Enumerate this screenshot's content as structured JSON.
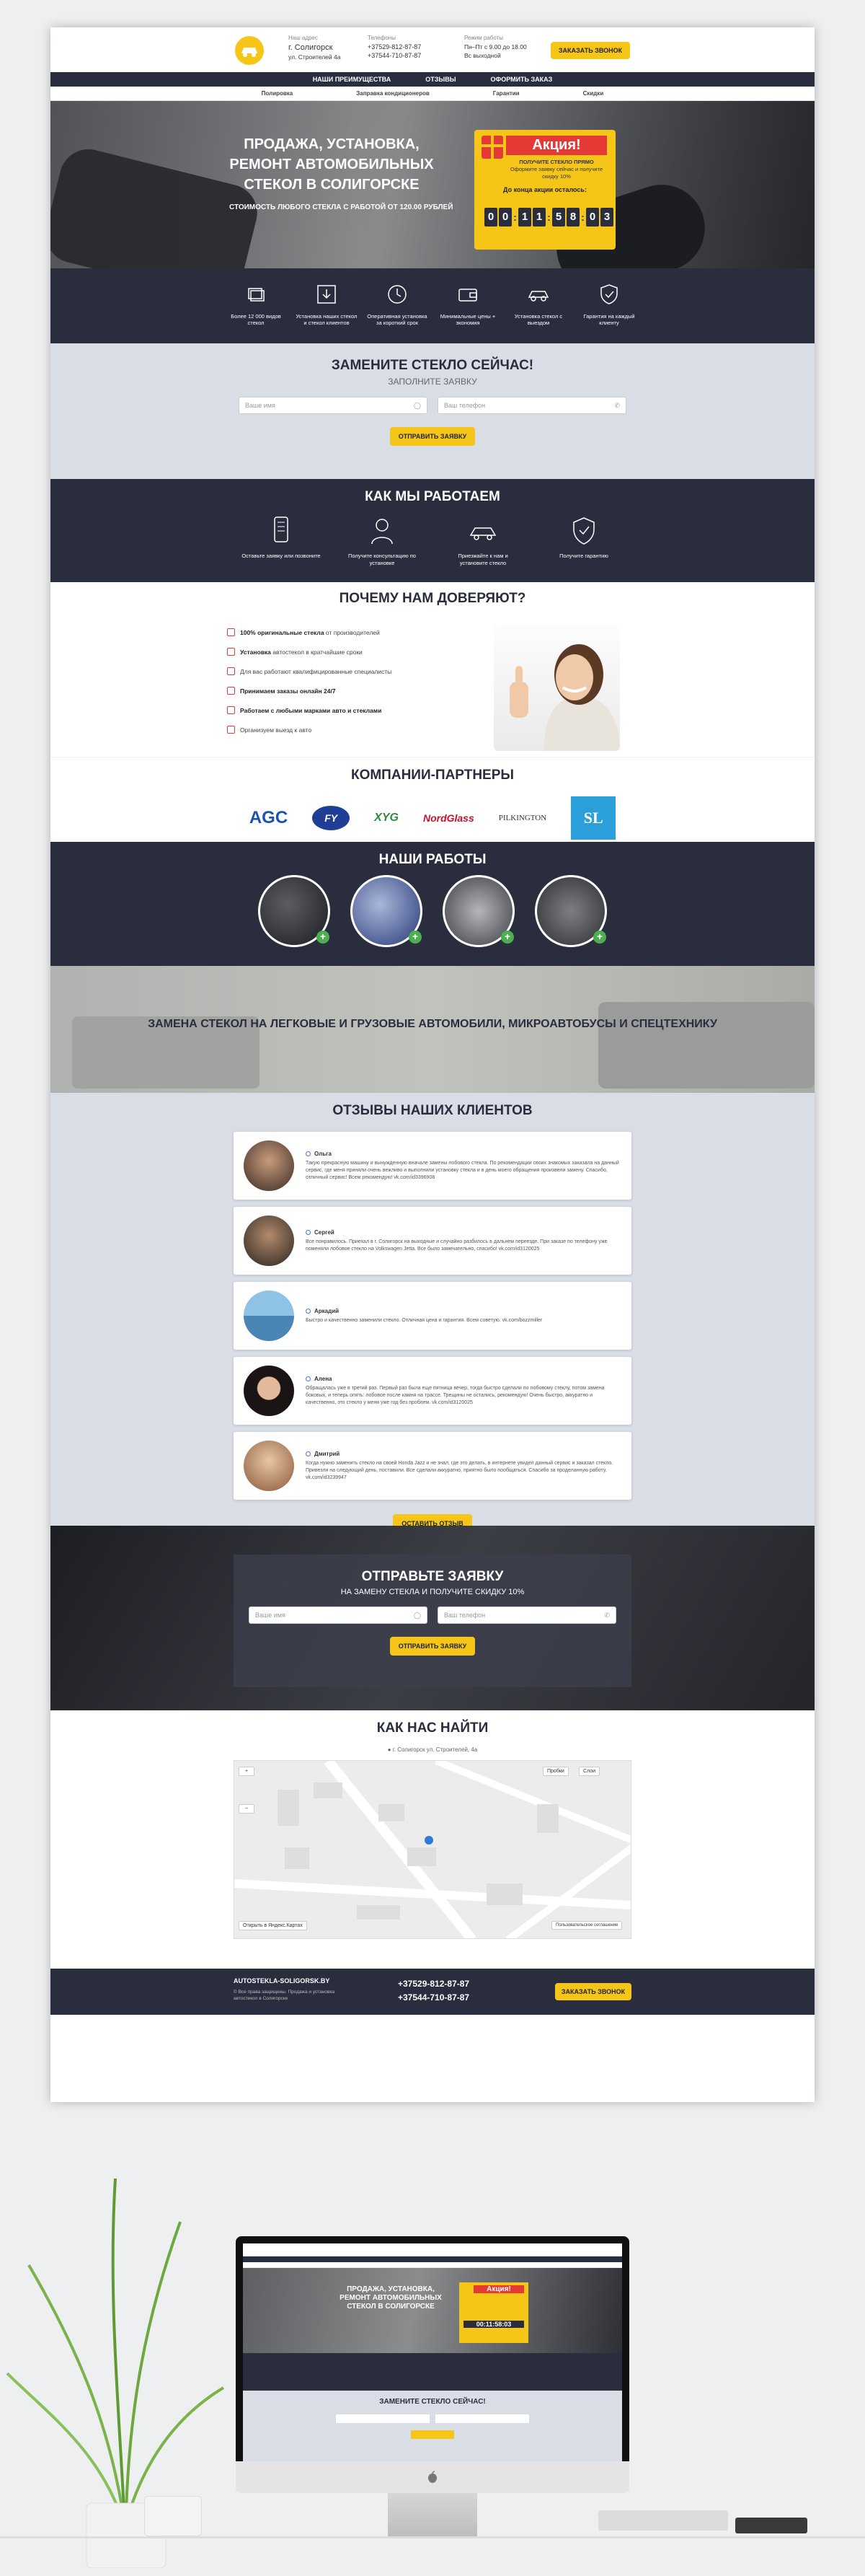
{
  "header": {
    "city_label": "Наш адрес",
    "city": "г. Солигорск",
    "street": "ул. Строителей 4а",
    "phones_label": "Телефоны",
    "phone1": "+37529-812-87-87",
    "phone2": "+37544-710-87-87",
    "hours_label": "Режим работы",
    "hours1": "Пн–Пт с 9.00 до 18.00",
    "hours2": "Вс выходной",
    "call_button": "Заказать звонок"
  },
  "nav_main": [
    "Наши преимущества",
    "Отзывы",
    "Оформить заказ"
  ],
  "nav_sub": [
    "Полировка",
    "Заправка кондиционеров",
    "Гарантии",
    "Скидки"
  ],
  "hero": {
    "title": "Продажа, установка, ремонт автомобильных стекол в Солигорске",
    "price": "Стоимость любого стекла с работой от 120.00 рублей",
    "promo_title": "Акция!",
    "promo_text": "Оформите заявку сейчас и получите скидку 10%",
    "promo_prefix": "ПОЛУЧИТЕ СТЕКЛО ПРЯМО",
    "countdown_label": "До конца акции осталось:",
    "timer": [
      "0",
      "0",
      "1",
      "1",
      "5",
      "8",
      "0",
      "3"
    ]
  },
  "features": [
    {
      "icon": "glass-stack-icon",
      "text": "Более 12 000 видов стекол"
    },
    {
      "icon": "download-box-icon",
      "text": "Установка наших стекол и стекол клиентов"
    },
    {
      "icon": "clock-icon",
      "text": "Оперативная установка за короткий срок"
    },
    {
      "icon": "wallet-icon",
      "text": "Минимальные цены + экономия"
    },
    {
      "icon": "car-icon",
      "text": "Установка стекол с выездом"
    },
    {
      "icon": "shield-check-icon",
      "text": "Гарантия на каждый клиенту"
    }
  ],
  "form1": {
    "title": "Замените стекло сейчас!",
    "subtitle": "Заполните заявку",
    "name_placeholder": "Ваше имя",
    "phone_placeholder": "Ваш телефон",
    "submit": "Отправить заявку"
  },
  "how": {
    "title": "Как мы работаем",
    "steps": [
      {
        "icon": "phone-icon",
        "text": "Оставьте заявку или позвоните"
      },
      {
        "icon": "consultant-icon",
        "text": "Получите консультацию по установке"
      },
      {
        "icon": "car-icon",
        "text": "Приезжайте к нам и установите стекло"
      },
      {
        "icon": "shield-check-icon",
        "text": "Получите гарантию"
      }
    ]
  },
  "trust": {
    "title": "Почему нам доверяют?",
    "items": [
      {
        "bold": "100% оригинальные стекла",
        "rest": " от производителей"
      },
      {
        "bold": "Установка",
        "rest": " автостекол в кратчайшие сроки"
      },
      {
        "bold": "",
        "rest": "Для вас работают квалифицированные специалисты"
      },
      {
        "bold": "Принимаем заказы онлайн 24/7",
        "rest": ""
      },
      {
        "bold": "Работаем с любыми марками авто и стеклами",
        "rest": ""
      },
      {
        "bold": "",
        "rest": "Организуем выезд к авто"
      }
    ]
  },
  "partners": {
    "title": "Компании-партнеры",
    "logos": [
      "AGC",
      "FY",
      "XYG",
      "NordGlass",
      "PILKINGTON",
      "SL"
    ]
  },
  "works": {
    "title": "Наши работы",
    "plus": "+"
  },
  "trucks": {
    "title": "Замена стекол на легковые и грузовые автомобили, микроавтобусы и спецтехнику"
  },
  "reviews": {
    "title": "Отзывы наших клиентов",
    "items": [
      {
        "name": "Ольга",
        "text": "Такую прекрасную машину и вынужденную вначале замены лобового стекла. По рекомендации своих знакомых заказала на данный сервис, где меня приняли очень вежливо и выполнили установку стекла и в день моего обращения произвели замену. Спасибо, отличный сервис! Всем рекомендую! vk.com/id3396908"
      },
      {
        "name": "Сергей",
        "text": "Все понравилось. Приехал в г. Солигорск на выходные и случайно разбилось в дальнем переезде. При заказе по телефону уже поменяли лобовое стекло на Volkswagen Jetta. Все было замечательно, спасибо! vk.com/id3120025"
      },
      {
        "name": "Аркадий",
        "text": "Быстро и качественно заменили стекло. Отличная цена и гарантия. Всем советую. vk.com/bozzmiller"
      },
      {
        "name": "Алена",
        "text": "Обращалась уже в третий раз. Первый раз была еще пятница вечер, тогда быстро сделали по лобовому стеклу, потом замена боковых, и теперь опять: лобовое после камня на трассе. Трещины не остались, рекомендую! Очень быстро, аккуратно и качественно, это стекло у меня уже год без проблем. vk.com/id3120025"
      },
      {
        "name": "Дмитрий",
        "text": "Когда нужно заменить стекло на своей Honda Jazz и не знал, где это делать, в интернете увидел данный сервис и заказал стекло. Привезли на следующий день, поставили. Все сделали аккуратно, приятно было пообщаться. Спасибо за проделанную работу. vk.com/id3239947"
      }
    ],
    "button": "Оставить отзыв"
  },
  "request": {
    "title": "Отправьте заявку",
    "subtitle": "На замену стекла и получите скидку 10%",
    "name_placeholder": "Ваше имя",
    "phone_placeholder": "Ваш телефон",
    "submit": "Отправить заявку"
  },
  "map": {
    "title": "Как нас найти",
    "address": "г. Солигорск ул. Строителей, 4а",
    "traffic": "Пробки",
    "layers": "Слои",
    "yandex": "Открыть в Яндекс.Картах",
    "terms": "Пользовательское соглашение"
  },
  "footer": {
    "site": "AUTOSTEKLA-SOLIGORSK.BY",
    "copyright": "© Все права защищены. Продажа и установка автостекол в Солигорске",
    "phone1": "+37529-812-87-87",
    "phone2": "+37544-710-87-87",
    "button": "Заказать звонок"
  },
  "mockup": {
    "title": "Продажа, установка, ремонт автомобильных стекол в Солигорске",
    "form_title": "Замените стекло сейчас!",
    "promo": "Акция!",
    "timer": "00:11:58:03"
  }
}
